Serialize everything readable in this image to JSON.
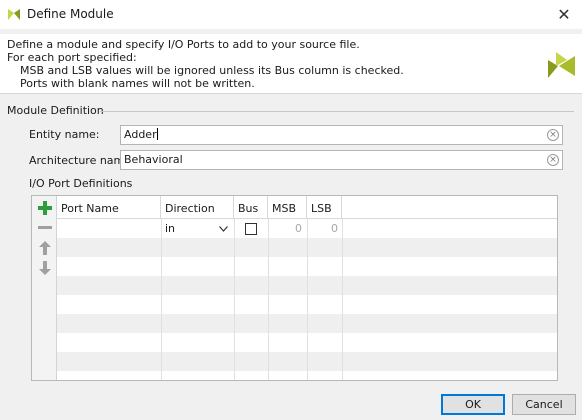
{
  "window": {
    "title": "Define Module",
    "close_glyph": "✕"
  },
  "banner": {
    "lines": [
      "Define a module and specify I/O Ports to add to your source file.",
      "For each port specified:",
      "MSB and LSB values will be ignored unless its Bus column is checked.",
      "Ports with blank names will not be written."
    ],
    "logo_icon": "vivado-logo-icon"
  },
  "module_definition": {
    "section_title": "Module Definition",
    "entity_label": "Entity name:",
    "entity_value": "Adder",
    "architecture_label": "Architecture name:",
    "architecture_value": "Behavioral",
    "clear_glyph": "×"
  },
  "ports": {
    "section_title": "I/O Port Definitions",
    "columns": [
      "Port Name",
      "Direction",
      "Bus",
      "MSB",
      "LSB"
    ],
    "rows": [
      {
        "port_name": "",
        "direction": "in",
        "bus": false,
        "msb": "0",
        "lsb": "0"
      }
    ],
    "toolbar": {
      "add_icon": "plus-icon",
      "remove_icon": "minus-icon",
      "up_icon": "arrow-up-icon",
      "down_icon": "arrow-down-icon"
    }
  },
  "buttons": {
    "ok": "OK",
    "cancel": "Cancel"
  },
  "colors": {
    "add_green": "#2e9e3a",
    "disabled_gray": "#a0a0a0",
    "logo_light": "#c5d44a",
    "logo_dark": "#8a9a1c",
    "accent_blue": "#0078d7"
  }
}
